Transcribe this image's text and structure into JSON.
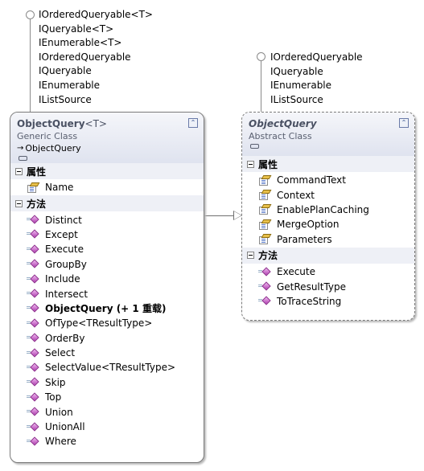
{
  "left_interfaces": [
    "IOrderedQueryable<T>",
    "IQueryable<T>",
    "IEnumerable<T>",
    "IOrderedQueryable",
    "IQueryable",
    "IEnumerable",
    "IListSource"
  ],
  "right_interfaces": [
    "IOrderedQueryable",
    "IQueryable",
    "IEnumerable",
    "IListSource"
  ],
  "generic_class": {
    "name": "ObjectQuery",
    "generic_suffix": "<T>",
    "kind": "Generic Class",
    "base": "ObjectQuery",
    "collapse_icon": "double-chevron-up-icon",
    "properties_label": "属性",
    "properties": [
      "Name"
    ],
    "methods_label": "方法",
    "methods": [
      {
        "name": "Distinct",
        "bold": false
      },
      {
        "name": "Except",
        "bold": false
      },
      {
        "name": "Execute",
        "bold": false
      },
      {
        "name": "GroupBy",
        "bold": false
      },
      {
        "name": "Include",
        "bold": false
      },
      {
        "name": "Intersect",
        "bold": false
      },
      {
        "name": "ObjectQuery (+ 1 重载)",
        "bold": true
      },
      {
        "name": "OfType<TResultType>",
        "bold": false
      },
      {
        "name": "OrderBy",
        "bold": false
      },
      {
        "name": "Select",
        "bold": false
      },
      {
        "name": "SelectValue<TResultType>",
        "bold": false
      },
      {
        "name": "Skip",
        "bold": false
      },
      {
        "name": "Top",
        "bold": false
      },
      {
        "name": "Union",
        "bold": false
      },
      {
        "name": "UnionAll",
        "bold": false
      },
      {
        "name": "Where",
        "bold": false
      }
    ]
  },
  "abstract_class": {
    "name": "ObjectQuery",
    "kind": "Abstract Class",
    "collapse_icon": "double-chevron-up-icon",
    "properties_label": "属性",
    "properties": [
      "CommandText",
      "Context",
      "EnablePlanCaching",
      "MergeOption",
      "Parameters"
    ],
    "methods_label": "方法",
    "methods": [
      "Execute",
      "GetResultType",
      "ToTraceString"
    ]
  },
  "relationship": "inheritance"
}
